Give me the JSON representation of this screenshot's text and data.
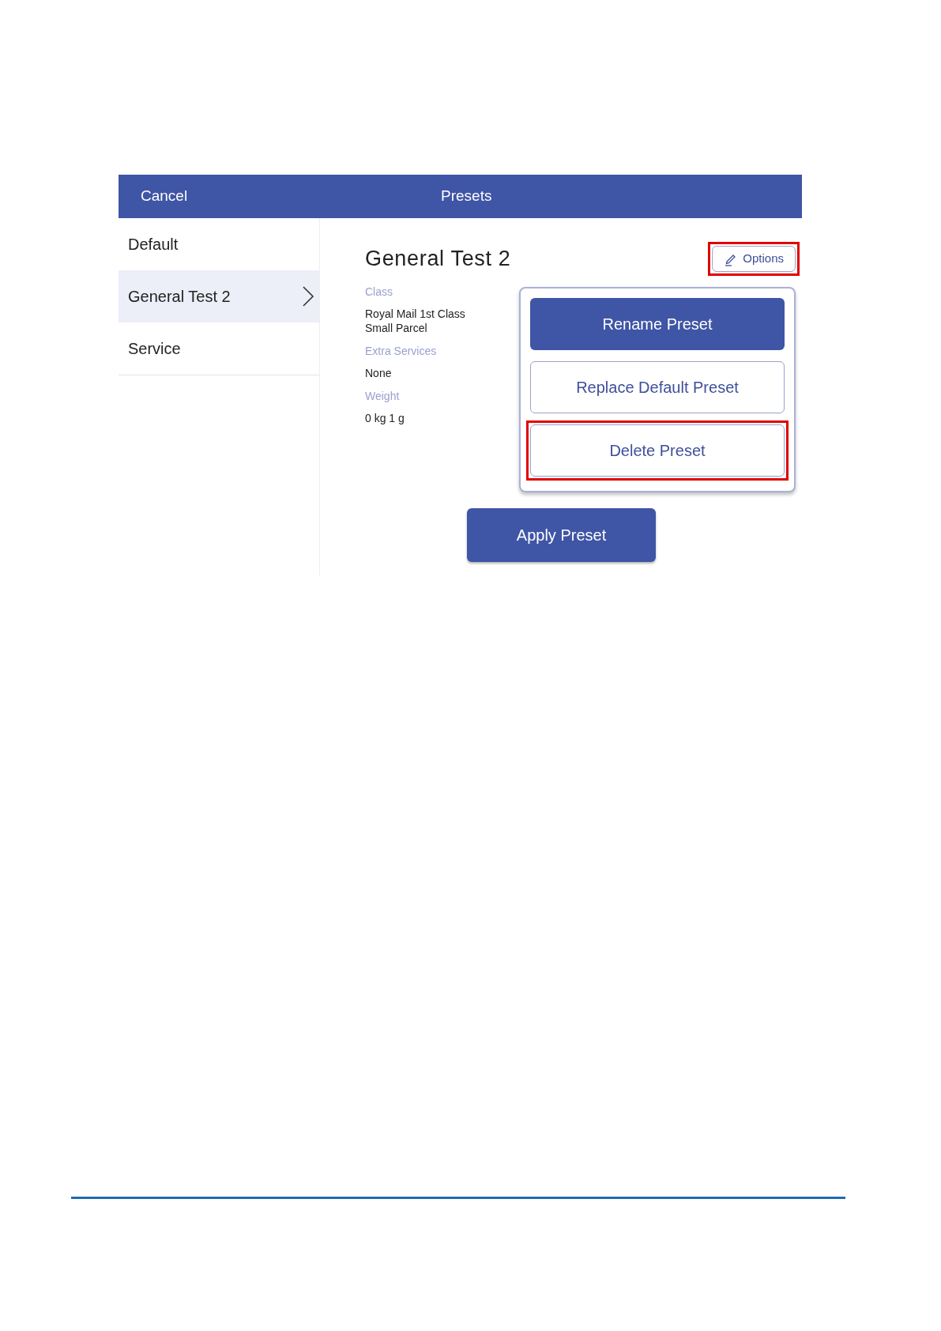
{
  "header": {
    "cancel": "Cancel",
    "title": "Presets"
  },
  "sidebar": {
    "items": [
      {
        "label": "Default",
        "selected": false
      },
      {
        "label": "General Test 2",
        "selected": true
      },
      {
        "label": "Service",
        "selected": false
      }
    ]
  },
  "detail": {
    "title": "General Test 2",
    "options_button": {
      "label": "Options",
      "highlighted": true
    },
    "fields": [
      {
        "label": "Class",
        "value": "Royal Mail 1st Class\nSmall Parcel"
      },
      {
        "label": "Extra Services",
        "value": "None"
      },
      {
        "label": "Weight",
        "value": "0 kg 1 g"
      }
    ]
  },
  "options_menu": [
    {
      "label": "Rename Preset",
      "kind": "primary",
      "highlighted": false
    },
    {
      "label": "Replace Default Preset",
      "kind": "outline",
      "highlighted": false
    },
    {
      "label": "Delete Preset",
      "kind": "outline",
      "highlighted": true
    }
  ],
  "apply_button": "Apply Preset"
}
